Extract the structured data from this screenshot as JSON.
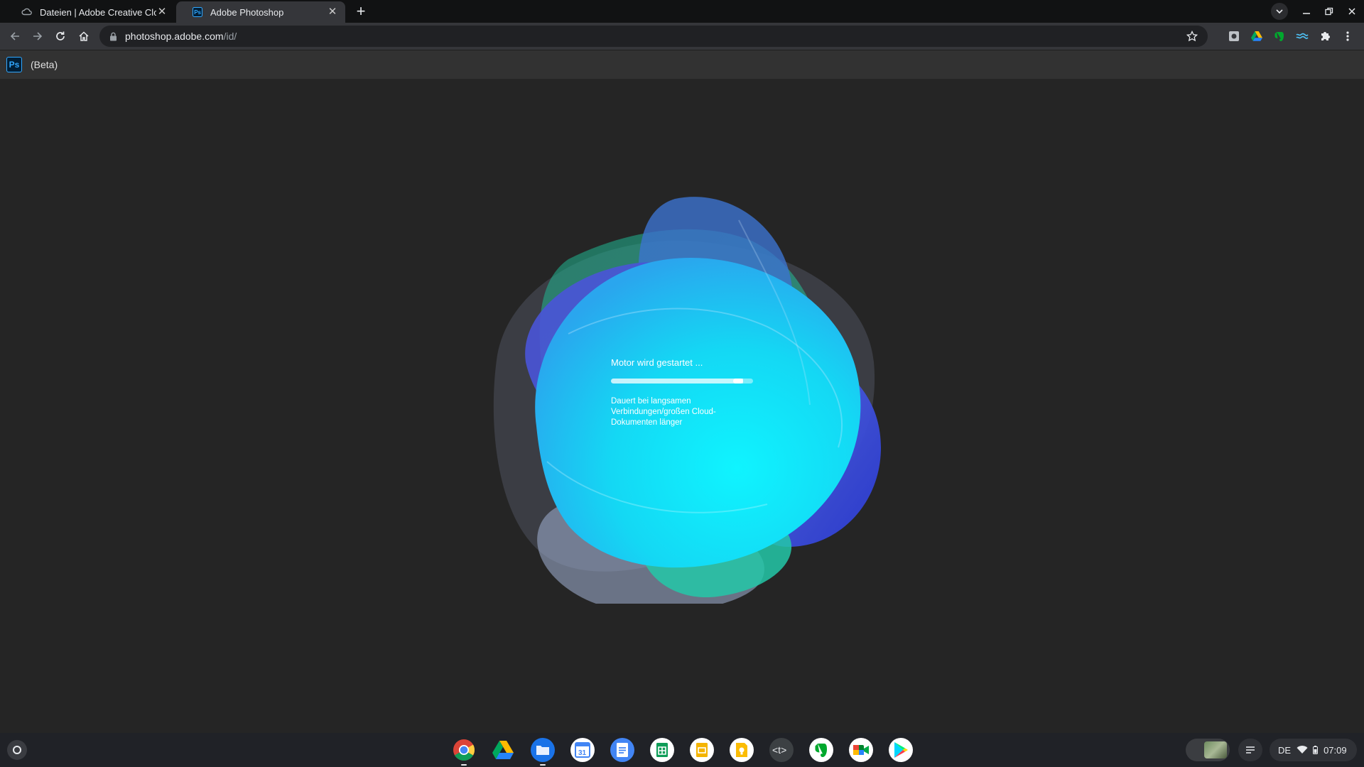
{
  "browser": {
    "tabs": [
      {
        "label": "Dateien | Adobe Creative Cloud",
        "icon": "creative-cloud-icon",
        "active": false
      },
      {
        "label": "Adobe Photoshop",
        "icon": "photoshop-icon",
        "active": true
      }
    ],
    "url": {
      "host": "photoshop.adobe.com",
      "path": "/id/"
    },
    "extensions": [
      "extension-icon",
      "google-drive-icon",
      "evernote-icon",
      "extension-icon",
      "puzzle-icon"
    ]
  },
  "app": {
    "logo_text": "Ps",
    "badge": "(Beta)"
  },
  "loader": {
    "title": "Motor wird gestartet ...",
    "progress": 0.93,
    "note": "Dauert bei langsamen Verbindungen/großen Cloud-Dokumenten länger"
  },
  "shelf": {
    "apps": [
      "chrome",
      "google-drive",
      "files",
      "google-calendar",
      "google-docs",
      "google-sheets",
      "google-slides",
      "google-keep",
      "text-editor",
      "evernote",
      "google-meet",
      "google-play-store"
    ],
    "calendar_day": "31",
    "status": {
      "language": "DE",
      "time": "07:09"
    }
  },
  "colors": {
    "page_bg": "#252525",
    "accent_cyan": "#14e4f4",
    "photoshop_blue": "#31a8ff"
  }
}
